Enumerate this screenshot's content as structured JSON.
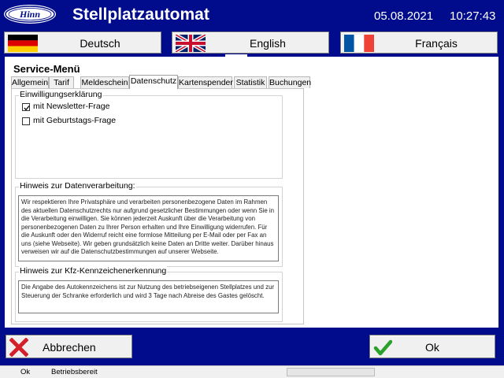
{
  "header": {
    "title": "Stellplatzautomat",
    "date": "05.08.2021",
    "time": "10:27:43",
    "logo_text": "Hinn"
  },
  "languages": [
    {
      "label": "Deutsch",
      "flag": "flag-germany-icon"
    },
    {
      "label": "English",
      "flag": "flag-uk-icon"
    },
    {
      "label": "Français",
      "flag": "flag-france-icon"
    }
  ],
  "panel": {
    "title": "Service-Menü",
    "tabs": [
      "Allgemein",
      "Tarif",
      "Meldeschein",
      "Datenschutz",
      "Kartenspender",
      "Statistik",
      "Buchungen"
    ],
    "active_tab": "Datenschutz"
  },
  "consent": {
    "title": "Einwilligungserklärung",
    "newsletter_label": "mit Newsletter-Frage",
    "newsletter_checked": true,
    "birthday_label": "mit Geburtstags-Frage",
    "birthday_checked": false
  },
  "privacy": {
    "title": "Hinweis zur Datenverarbeitung:",
    "text": "Wir respektieren Ihre Privatsphäre und verarbeiten personenbezogene Daten im Rahmen des aktuellen Datenschutzrechts nur aufgrund gesetzlicher Bestimmungen oder wenn Sie in die Verarbeitung einwilligen. Sie können jederzeit Auskunft über die Verarbeitung von personenbezogenen Daten zu Ihrer Person erhalten und Ihre Einwilligung widerrufen. Für die Auskunft oder den Widerruf reicht eine formlose Mitteilung per E-Mail oder per Fax an uns (siehe Webseite). Wir geben grundsätzlich keine Daten an Dritte weiter. Darüber hinaus verweisen wir auf die Datenschutzbestimmungen auf unserer Webseite."
  },
  "plate": {
    "title": "Hinweis zur Kfz-Kennzeichenerkennung",
    "text": "Die Angabe des Autokennzeichens ist zur Nutzung des betriebseigenen Stellplatzes und zur Steuerung der Schranke erforderlich und wird 3 Tage nach Abreise des Gastes gelöscht."
  },
  "buttons": {
    "cancel": "Abbrechen",
    "ok": "Ok"
  },
  "statusbar": {
    "status": "Ok",
    "message": "Betriebsbereit"
  },
  "colors": {
    "header_bg": "#000c8c",
    "cancel_icon": "#d4202a",
    "ok_icon": "#2aa12a"
  }
}
